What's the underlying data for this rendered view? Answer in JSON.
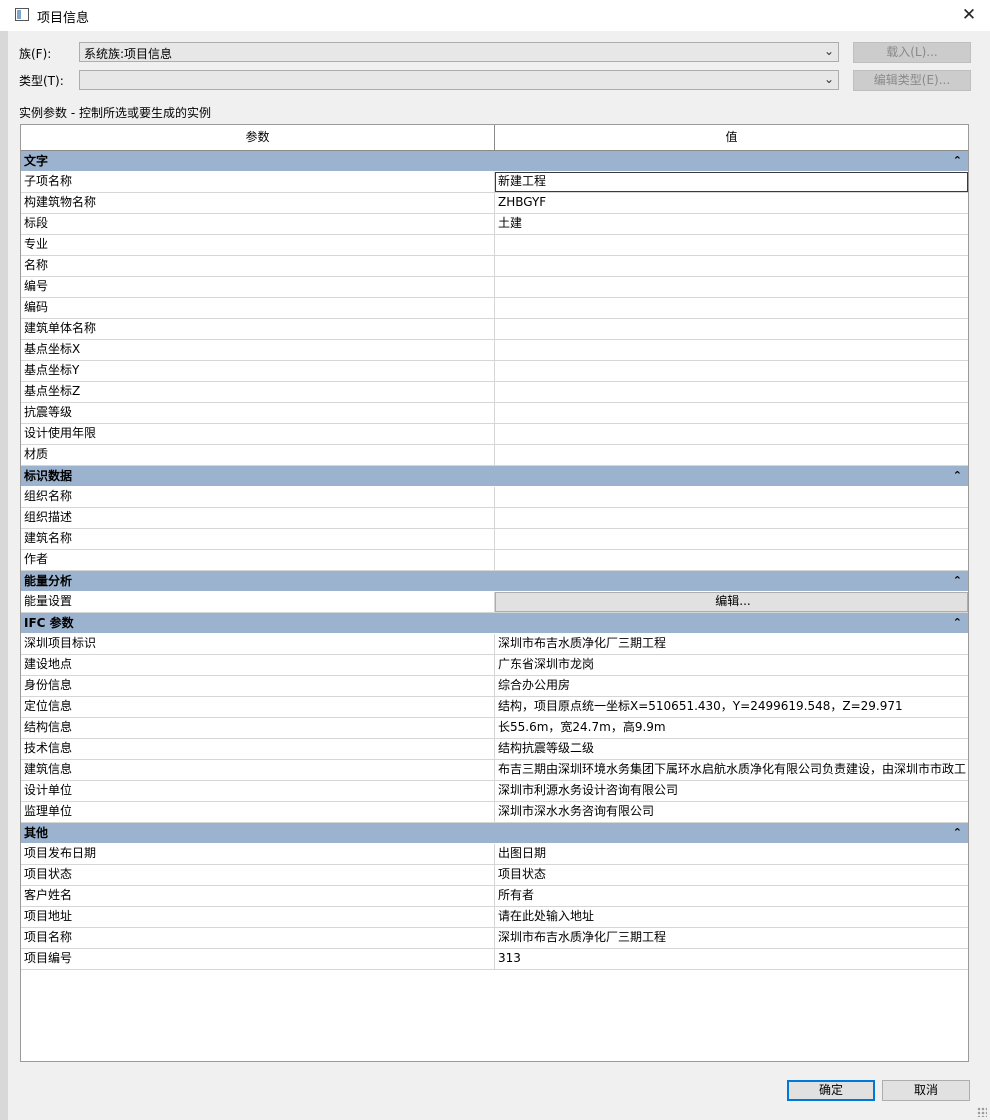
{
  "window": {
    "title": "项目信息",
    "close_symbol": "✕"
  },
  "family": {
    "label": "族(F):",
    "value": "系统族:项目信息",
    "load_button": "载入(L)..."
  },
  "type": {
    "label": "类型(T):",
    "value": "",
    "edit_type_button": "编辑类型(E)..."
  },
  "instance_note": "实例参数 - 控制所选或要生成的实例",
  "grid": {
    "headers": {
      "param": "参数",
      "value": "值"
    },
    "groups": {
      "text": {
        "title": "文字",
        "rows": [
          {
            "k": "子项名称",
            "v": "新建工程"
          },
          {
            "k": "构建筑物名称",
            "v": "ZHBGYF"
          },
          {
            "k": "标段",
            "v": "土建"
          },
          {
            "k": "专业",
            "v": ""
          },
          {
            "k": "名称",
            "v": ""
          },
          {
            "k": "编号",
            "v": ""
          },
          {
            "k": "编码",
            "v": ""
          },
          {
            "k": "建筑单体名称",
            "v": ""
          },
          {
            "k": "基点坐标X",
            "v": ""
          },
          {
            "k": "基点坐标Y",
            "v": ""
          },
          {
            "k": "基点坐标Z",
            "v": ""
          },
          {
            "k": "抗震等级",
            "v": ""
          },
          {
            "k": "设计使用年限",
            "v": ""
          },
          {
            "k": "材质",
            "v": ""
          }
        ]
      },
      "identity": {
        "title": "标识数据",
        "rows": [
          {
            "k": "组织名称",
            "v": ""
          },
          {
            "k": "组织描述",
            "v": ""
          },
          {
            "k": "建筑名称",
            "v": ""
          },
          {
            "k": "作者",
            "v": ""
          }
        ]
      },
      "energy": {
        "title": "能量分析",
        "rows": [
          {
            "k": "能量设置",
            "v": "编辑..."
          }
        ]
      },
      "ifc": {
        "title": "IFC 参数",
        "rows": [
          {
            "k": "深圳项目标识",
            "v": "深圳市布吉水质净化厂三期工程"
          },
          {
            "k": "建设地点",
            "v": "广东省深圳市龙岗"
          },
          {
            "k": "身份信息",
            "v": "综合办公用房"
          },
          {
            "k": "定位信息",
            "v": "结构，项目原点统一坐标X=510651.430，Y=2499619.548，Z=29.971"
          },
          {
            "k": "结构信息",
            "v": "长55.6m，宽24.7m，高9.9m"
          },
          {
            "k": "技术信息",
            "v": "结构抗震等级二级"
          },
          {
            "k": "建筑信息",
            "v": "布吉三期由深圳环境水务集团下属环水启航水质净化有限公司负责建设，由深圳市市政工"
          },
          {
            "k": "设计单位",
            "v": "深圳市利源水务设计咨询有限公司"
          },
          {
            "k": "监理单位",
            "v": "深圳市深水水务咨询有限公司"
          }
        ]
      },
      "other": {
        "title": "其他",
        "rows": [
          {
            "k": "项目发布日期",
            "v": "出图日期"
          },
          {
            "k": "项目状态",
            "v": "项目状态"
          },
          {
            "k": "客户姓名",
            "v": "所有者"
          },
          {
            "k": "项目地址",
            "v": "请在此处输入地址"
          },
          {
            "k": "项目名称",
            "v": "深圳市布吉水质净化厂三期工程"
          },
          {
            "k": "项目编号",
            "v": "313"
          }
        ]
      }
    },
    "collapse_symbol": "⌃"
  },
  "footer": {
    "ok": "确定",
    "cancel": "取消"
  }
}
